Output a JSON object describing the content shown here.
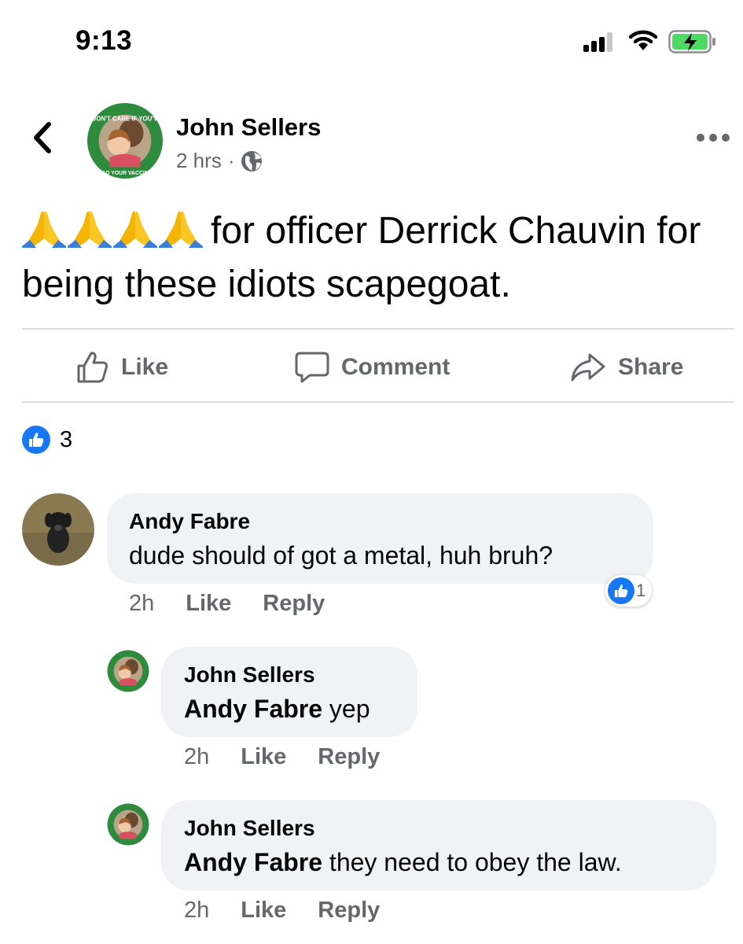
{
  "status_bar": {
    "time": "9:13"
  },
  "post": {
    "author": "John Sellers",
    "time": "2 hrs",
    "dot": "·",
    "text": "for officer Derrick Chauvin for being these idiots scapegoat.",
    "emoji_count": 4
  },
  "actions": {
    "like": "Like",
    "comment": "Comment",
    "share": "Share"
  },
  "reactions": {
    "count": "3"
  },
  "comments": [
    {
      "author": "Andy Fabre",
      "mention": "",
      "text": "dude should of got a metal, huh bruh?",
      "time": "2h",
      "like": "Like",
      "reply": "Reply",
      "reaction_count": "1"
    },
    {
      "author": "John Sellers",
      "mention": "Andy Fabre",
      "text": " yep",
      "time": "2h",
      "like": "Like",
      "reply": "Reply"
    },
    {
      "author": "John Sellers",
      "mention": "Andy Fabre",
      "text": " they need to obey the law.",
      "time": "2h",
      "like": "Like",
      "reply": "Reply"
    }
  ],
  "avatar_badge_text": {
    "top": "I DON'T CARE IF YOU'VE",
    "bottom": "HAD YOUR VACCINE"
  },
  "colors": {
    "accent": "#1877f2",
    "secondary_text": "#65676b",
    "bubble": "#f0f2f5",
    "badge_ring": "#2e8b3e"
  }
}
